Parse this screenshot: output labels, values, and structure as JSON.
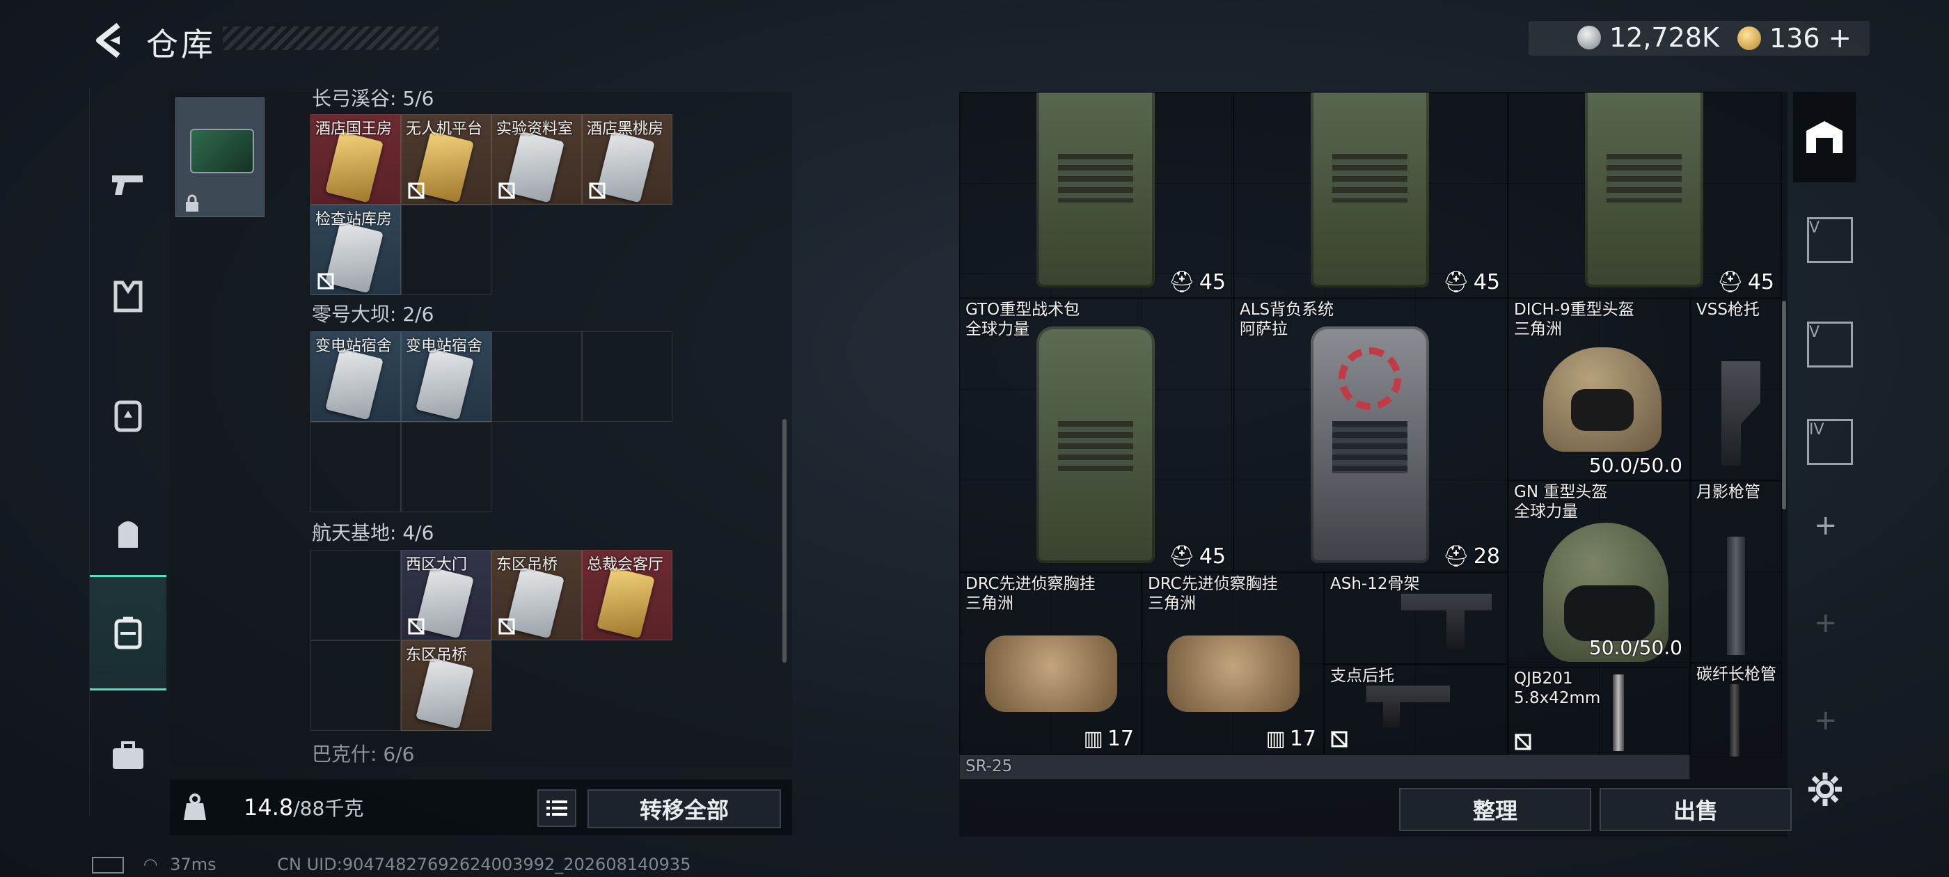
{
  "header": {
    "title": "仓库",
    "currency_silver": "12,728K",
    "currency_gold": "136",
    "add_symbol": "+"
  },
  "sidebar": {
    "items": [
      "weapon-tab",
      "vest-tab",
      "armor-tab",
      "backpack-tab",
      "storage-tab",
      "case-tab"
    ],
    "active": "storage-tab"
  },
  "left": {
    "section1": "长弓溪谷: 5/6",
    "section1_cells": [
      "酒店国王房",
      "无人机平台",
      "实验资料室",
      "酒店黑桃房",
      "检查站库房"
    ],
    "section2": "零号大坝: 2/6",
    "section2_cells": [
      "变电站宿舍",
      "变电站宿舍"
    ],
    "section3": "航天基地: 4/6",
    "section3_cells": [
      "西区大门",
      "东区吊桥",
      "总裁会客厅",
      "东区吊桥"
    ],
    "section4": "巴克什: 6/6",
    "weight_value": "14.8",
    "weight_max": "/88千克",
    "transfer_all": "转移全部"
  },
  "right": {
    "top_counts": [
      "45",
      "45",
      "45"
    ],
    "items": [
      {
        "name": "GTO重型战术包",
        "sub": "全球力量",
        "count": "45"
      },
      {
        "name": "ALS背负系统",
        "sub": "阿萨拉",
        "count": "28"
      },
      {
        "name": "DICH-9重型头盔",
        "sub": "三角洲",
        "durability": "50.0/50.0"
      },
      {
        "name": "VSS枪托",
        "sub": ""
      },
      {
        "name": "GN 重型头盔",
        "sub": "全球力量",
        "durability": "50.0/50.0"
      },
      {
        "name": "月影枪管",
        "sub": ""
      },
      {
        "name": "DRC先进侦察胸挂",
        "sub": "三角洲",
        "count": "17"
      },
      {
        "name": "DRC先进侦察胸挂",
        "sub": "三角洲",
        "count": "17"
      },
      {
        "name": "ASh-12骨架",
        "sub": ""
      },
      {
        "name": "支点后托",
        "sub": ""
      },
      {
        "name": "QJB201",
        "sub": "5.8x42mm"
      },
      {
        "name": "碳纤长枪管",
        "sub": ""
      },
      {
        "name": "SR-25",
        "sub": ""
      }
    ],
    "sort_btn": "整理",
    "sell_btn": "出售"
  },
  "status": {
    "ping": "37ms",
    "uid": "CN UID:904748276926240039​92_202608140935"
  },
  "colors": {
    "accent": "#4fe3c1",
    "red_cell": "#6b2a30",
    "brown_cell": "#4d3a2e",
    "navy_cell": "#323449"
  }
}
